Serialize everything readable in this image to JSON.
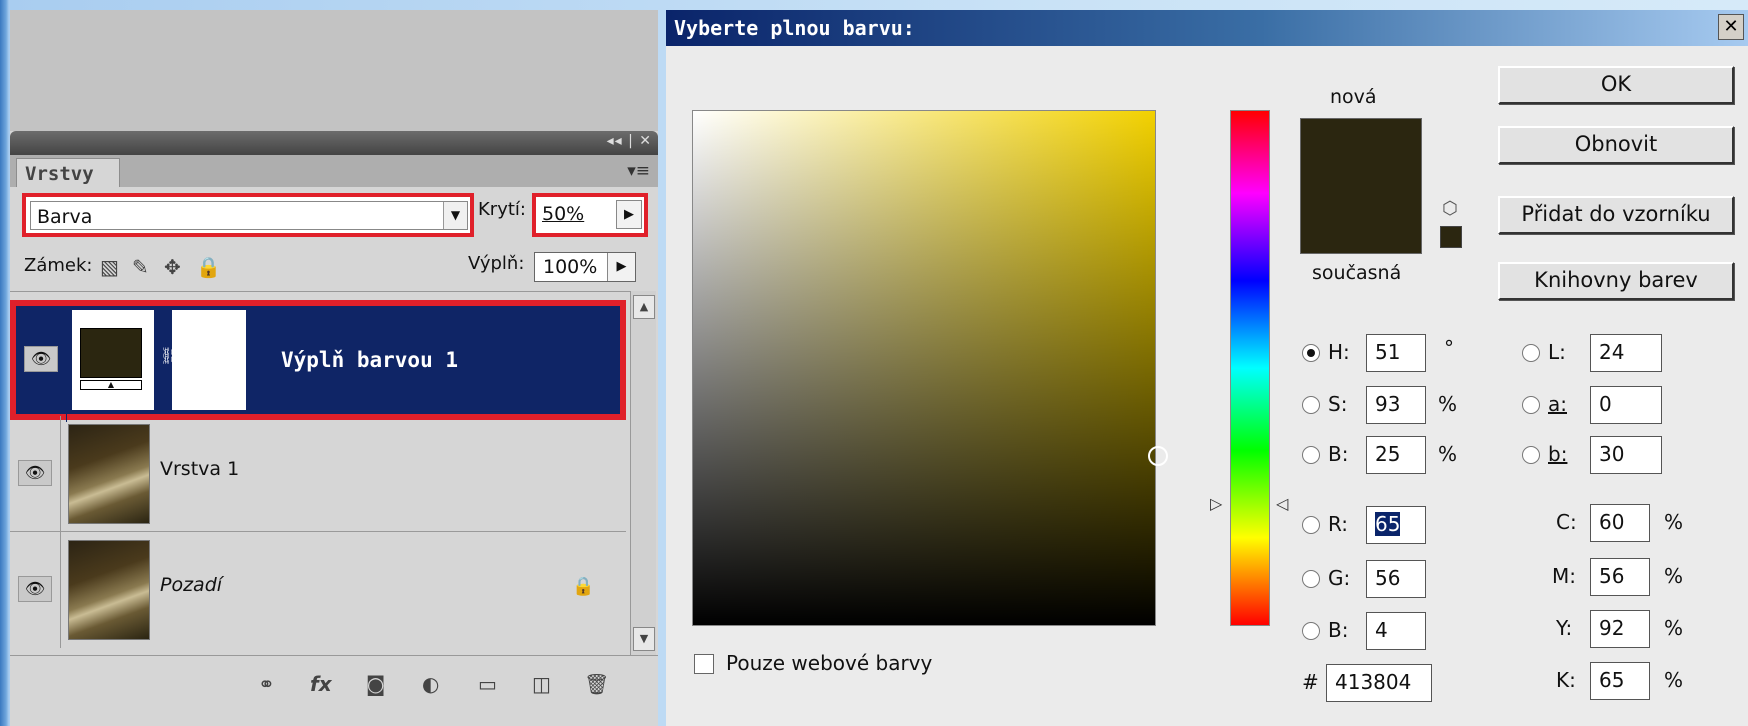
{
  "layers_panel": {
    "tab": "Vrstvy",
    "blend_mode": "Barva",
    "opacity_label": "Krytí:",
    "opacity": "50%",
    "lock_label": "Zámek:",
    "fill_label": "Výplň:",
    "fill": "100%",
    "layers": [
      {
        "name": "Výplň barvou 1",
        "selected": true,
        "type": "fill"
      },
      {
        "name": "Vrstva 1",
        "selected": false,
        "type": "image"
      },
      {
        "name": "Pozadí",
        "selected": false,
        "type": "background",
        "locked": true
      }
    ]
  },
  "dialog": {
    "title": "Vyberte plnou barvu:",
    "new_label": "nová",
    "current_label": "současná",
    "buttons": {
      "ok": "OK",
      "reset": "Obnovit",
      "add_swatch": "Přidat do vzorníku",
      "libraries": "Knihovny barev"
    },
    "web_only_label": "Pouze webové barvy",
    "fields": {
      "h": {
        "label": "H:",
        "value": "51",
        "unit": "°"
      },
      "s": {
        "label": "S:",
        "value": "93",
        "unit": "%"
      },
      "b": {
        "label": "B:",
        "value": "25",
        "unit": "%"
      },
      "r": {
        "label": "R:",
        "value": "65"
      },
      "g": {
        "label": "G:",
        "value": "56"
      },
      "bb": {
        "label": "B:",
        "value": "4"
      },
      "l": {
        "label": "L:",
        "value": "24"
      },
      "a": {
        "label": "a:",
        "value": "0"
      },
      "lab_b": {
        "label": "b:",
        "value": "30"
      },
      "c": {
        "label": "C:",
        "value": "60",
        "unit": "%"
      },
      "m": {
        "label": "M:",
        "value": "56",
        "unit": "%"
      },
      "y": {
        "label": "Y:",
        "value": "92",
        "unit": "%"
      },
      "k": {
        "label": "K:",
        "value": "65",
        "unit": "%"
      }
    },
    "hex_label": "#",
    "hex": "413804",
    "color": "#413804"
  }
}
